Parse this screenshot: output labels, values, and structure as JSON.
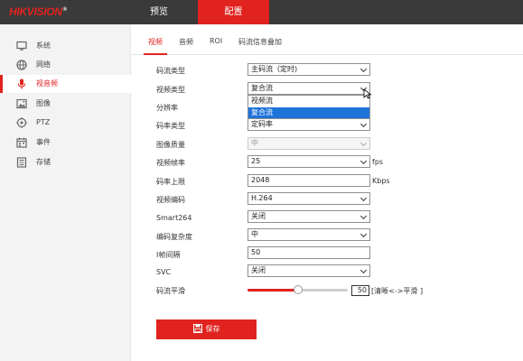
{
  "brand": {
    "name": "HIKVISION",
    "mark": "®",
    "color": "#e0231f"
  },
  "top_nav": [
    {
      "label": "预览",
      "active": false
    },
    {
      "label": "配置",
      "active": true
    }
  ],
  "sidebar": {
    "items": [
      {
        "label": "系统",
        "icon": "monitor-icon",
        "active": false
      },
      {
        "label": "网络",
        "icon": "globe-icon",
        "active": false
      },
      {
        "label": "视音频",
        "icon": "microphone-icon",
        "active": true
      },
      {
        "label": "图像",
        "icon": "image-icon",
        "active": false
      },
      {
        "label": "PTZ",
        "icon": "ptz-icon",
        "active": false
      },
      {
        "label": "事件",
        "icon": "calendar-icon",
        "active": false
      },
      {
        "label": "存储",
        "icon": "storage-icon",
        "active": false
      }
    ]
  },
  "tabs": [
    {
      "label": "视频",
      "active": true
    },
    {
      "label": "音频",
      "active": false
    },
    {
      "label": "ROI",
      "active": false
    },
    {
      "label": "码流信息叠加",
      "active": false
    }
  ],
  "form": {
    "stream_type": {
      "label": "码流类型",
      "value": "主码流（定时)"
    },
    "video_type": {
      "label": "视频类型",
      "value": "复合流",
      "options": [
        "视频流",
        "复合流"
      ],
      "highlighted": "复合流"
    },
    "resolution": {
      "label": "分辨率"
    },
    "bitrate_type": {
      "label": "码率类型",
      "value": "定码率"
    },
    "image_quality": {
      "label": "图像质量",
      "value": "中"
    },
    "frame_rate": {
      "label": "视频帧率",
      "value": "25",
      "unit": "fps"
    },
    "max_bitrate": {
      "label": "码率上限",
      "value": "2048",
      "unit": "Kbps"
    },
    "encoding": {
      "label": "视频编码",
      "value": "H.264"
    },
    "smart264": {
      "label": "Smart264",
      "value": "关闭"
    },
    "complexity": {
      "label": "编码复杂度",
      "value": "中"
    },
    "i_frame_interval": {
      "label": "I帧间隔",
      "value": "50"
    },
    "svc": {
      "label": "SVC",
      "value": "关闭"
    },
    "smoothing": {
      "label": "码流平滑",
      "value": "50",
      "level": 0.5,
      "hint": "[清晰<->平滑 ]"
    }
  },
  "save_label": "保存"
}
